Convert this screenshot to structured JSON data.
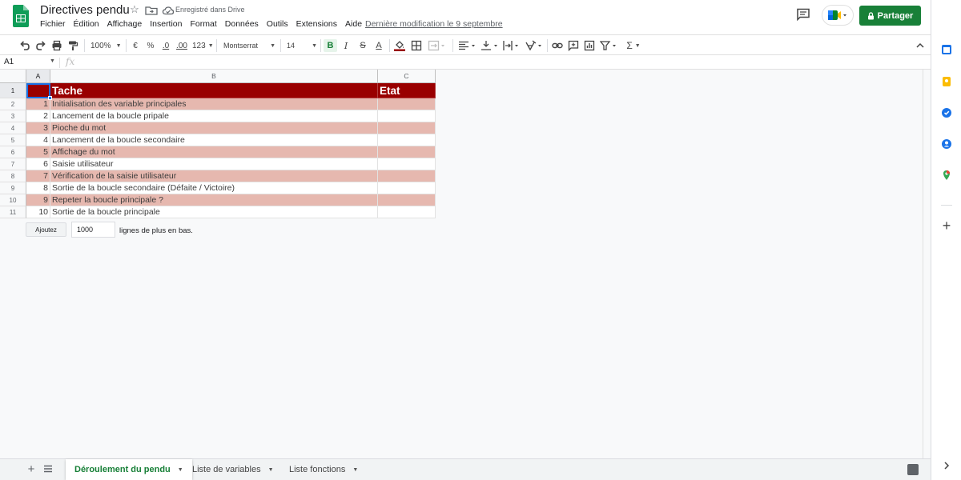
{
  "document": {
    "title": "Directives pendu",
    "save_status": "Enregistré dans Drive",
    "last_modified": "Dernière modification le 9 septembre"
  },
  "menu": [
    "Fichier",
    "Édition",
    "Affichage",
    "Insertion",
    "Format",
    "Données",
    "Outils",
    "Extensions",
    "Aide"
  ],
  "header": {
    "share_label": "Partager"
  },
  "toolbar": {
    "zoom": "100%",
    "currency": "€",
    "percent": "%",
    "decimal_decrease": ".0",
    "decimal_increase": ".00",
    "format_more": "123",
    "font": "Montserrat",
    "font_size": "14",
    "bold": "B",
    "italic": "I",
    "strike": "S",
    "text_color": "A",
    "sigma": "Σ"
  },
  "formula_bar": {
    "cell_ref": "A1",
    "fx": "fx"
  },
  "grid": {
    "columns": [
      "A",
      "B",
      "C"
    ],
    "row_numbers": [
      "1",
      "2",
      "3",
      "4",
      "5",
      "6",
      "7",
      "8",
      "9",
      "10",
      "11"
    ],
    "header_row": {
      "a": "",
      "b": "Tache",
      "c": "Etat"
    },
    "rows": [
      {
        "a": "1",
        "b": "Initialisation des variable principales",
        "c": ""
      },
      {
        "a": "2",
        "b": "Lancement de la boucle pripale",
        "c": ""
      },
      {
        "a": "3",
        "b": "Pioche du mot",
        "c": ""
      },
      {
        "a": "4",
        "b": "Lancement de la boucle secondaire",
        "c": ""
      },
      {
        "a": "5",
        "b": "Affichage du mot",
        "c": ""
      },
      {
        "a": "6",
        "b": "Saisie utilisateur",
        "c": ""
      },
      {
        "a": "7",
        "b": "Vérification de la saisie utilisateur",
        "c": ""
      },
      {
        "a": "8",
        "b": "Sortie de la boucle secondaire (Défaite / Victoire)",
        "c": ""
      },
      {
        "a": "9",
        "b": "Repeter la boucle principale ?",
        "c": ""
      },
      {
        "a": "10",
        "b": "Sortie de la boucle principale",
        "c": ""
      }
    ],
    "header_color": "#990000",
    "band_color": "#e6b8af"
  },
  "add_rows": {
    "button": "Ajoutez",
    "count": "1000",
    "suffix": "lignes de plus en bas."
  },
  "sheets": [
    {
      "label": "Déroulement du pendu",
      "active": true
    },
    {
      "label": "Liste de variables",
      "active": false
    },
    {
      "label": "Liste fonctions",
      "active": false
    }
  ],
  "colors": {
    "brand_green": "#188038",
    "selection_blue": "#1a73e8"
  }
}
